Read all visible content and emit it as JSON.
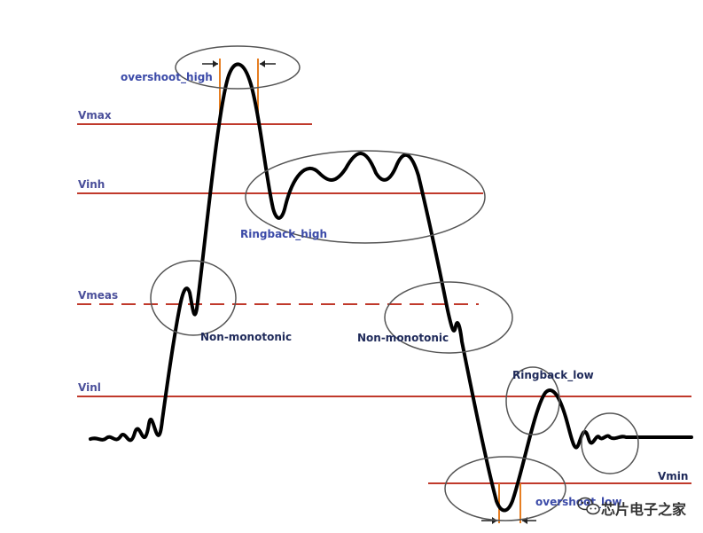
{
  "levels": {
    "vmax": "Vmax",
    "vinh": "Vinh",
    "vmeas": "Vmeas",
    "vinl": "Vinl",
    "vmin": "Vmin"
  },
  "annotations": {
    "overshoot_high": "overshoot_high",
    "ringback_high": "Ringback_high",
    "non_monotonic_rise": "Non-monotonic",
    "non_monotonic_fall": "Non-monotonic",
    "ringback_low": "Ringback_low",
    "overshoot_low": "overshoot_low"
  },
  "watermark": {
    "text": "芯片电子之家",
    "icon": "wechat-icon"
  },
  "colors": {
    "level_line": "#c0392b",
    "waveform": "#000000",
    "ellipse": "#555555",
    "marker": "#e67e22"
  }
}
